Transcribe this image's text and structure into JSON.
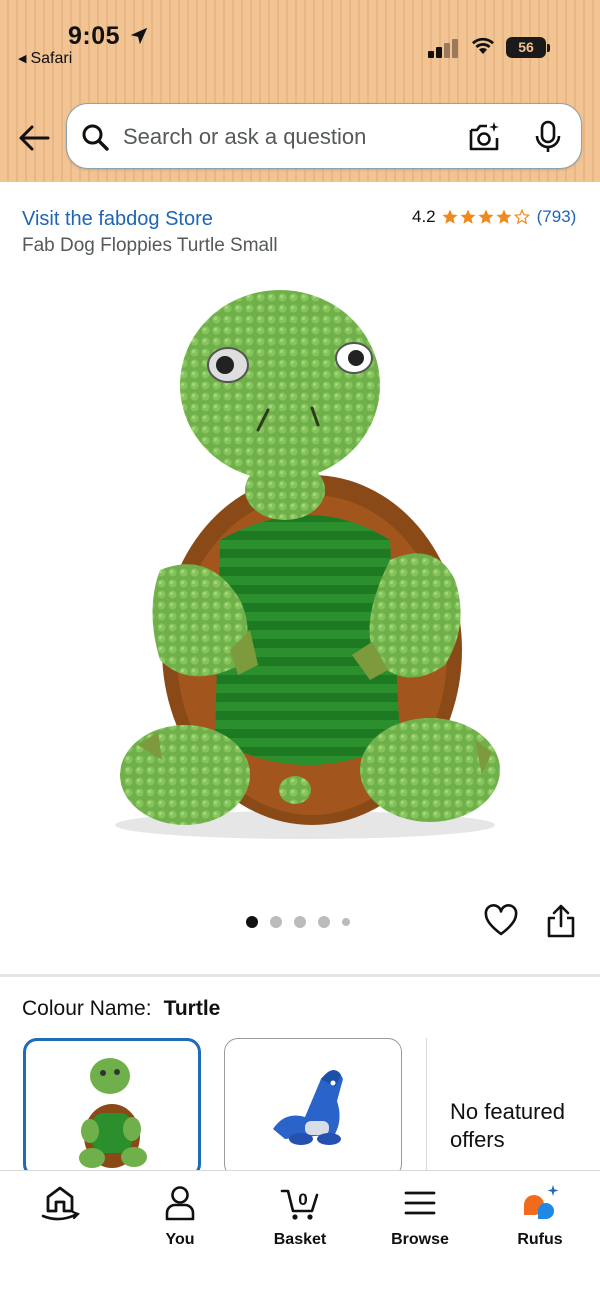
{
  "status_bar": {
    "time": "9:05",
    "back_app": "Safari",
    "battery": "56"
  },
  "search": {
    "placeholder": "Search or ask a question"
  },
  "product": {
    "store_link": "Visit the fabdog Store",
    "title": "Fab Dog Floppies Turtle Small",
    "rating_value": "4.2",
    "rating_stars": 4.2,
    "rating_count": "(793)"
  },
  "gallery": {
    "image_count": 5,
    "active_index": 0
  },
  "colour": {
    "label": "Colour Name:",
    "value": "Turtle"
  },
  "offers": {
    "text": "No featured offers"
  },
  "bottom_nav": {
    "items": [
      {
        "label": "",
        "icon": "home-icon"
      },
      {
        "label": "You",
        "icon": "person-icon"
      },
      {
        "label": "Basket",
        "icon": "basket-icon",
        "badge": "0"
      },
      {
        "label": "Browse",
        "icon": "menu-icon"
      },
      {
        "label": "Rufus",
        "icon": "rufus-icon"
      }
    ]
  },
  "colors": {
    "header": "#f2c393",
    "link": "#1f64b8",
    "star": "#f18a1c",
    "selected_border": "#1e6bb8"
  }
}
